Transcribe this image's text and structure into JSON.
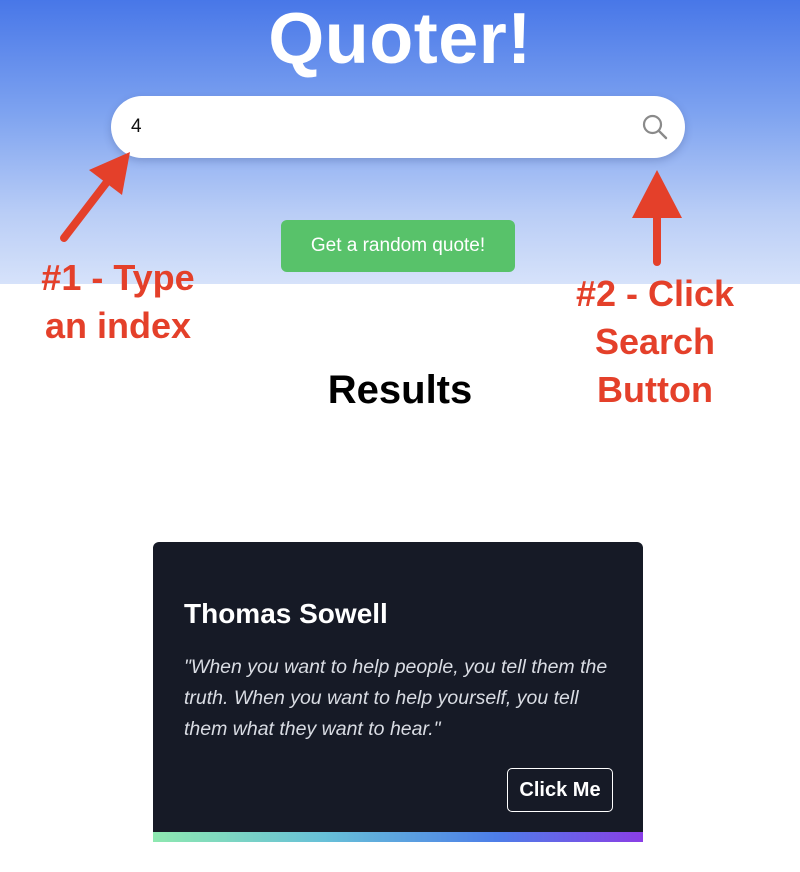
{
  "app": {
    "title": "Quoter!"
  },
  "search": {
    "value": "4",
    "icon": "search-icon"
  },
  "random_button": {
    "label": "Get a random quote!"
  },
  "results": {
    "heading": "Results"
  },
  "card": {
    "author": "Thomas Sowell",
    "quote": "\"When you want to help people, you tell them the truth. When you want to help yourself, you tell them what they want to hear.\"",
    "button_label": "Click Me"
  },
  "annotations": {
    "step1_line1": "#1 - Type",
    "step1_line2": "an index",
    "step2_line1": "#2 - Click",
    "step2_line2": "Search",
    "step2_line3": "Button"
  },
  "colors": {
    "hero_top": "#4877e8",
    "random_button": "#58c26a",
    "card_background": "#161a26",
    "annotation": "#e4402a"
  }
}
